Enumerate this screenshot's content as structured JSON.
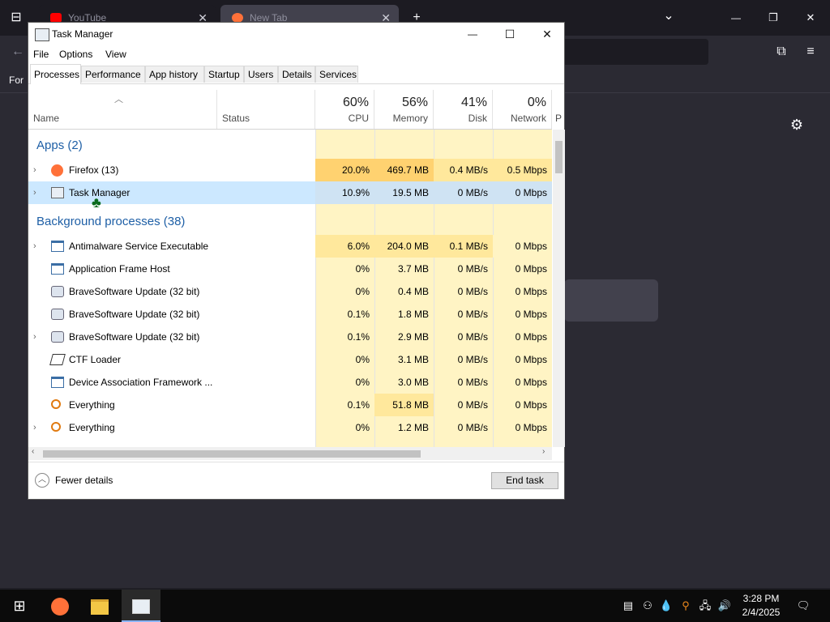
{
  "browser": {
    "tabs": [
      {
        "label": "YouTube",
        "favicon_color": "#ff0000"
      },
      {
        "label": "New Tab",
        "favicon_color": "#ff7139"
      }
    ],
    "new_tab_symbol": "+",
    "list_tabs_symbol": "⌄",
    "window_controls": {
      "minimize": "—",
      "restore": "❐",
      "close": "✕"
    },
    "bookmarks_bar_text": "For"
  },
  "task_manager": {
    "title": "Task Manager",
    "window_controls": {
      "minimize": "—",
      "maximize": "☐",
      "close": "✕"
    },
    "menu": [
      "File",
      "Options",
      "View"
    ],
    "tabs": [
      "Processes",
      "Performance",
      "App history",
      "Startup",
      "Users",
      "Details",
      "Services"
    ],
    "active_tab": "Processes",
    "columns": {
      "name": "Name",
      "status": "Status",
      "cpu": {
        "label": "CPU",
        "percent": "60%"
      },
      "memory": {
        "label": "Memory",
        "percent": "56%"
      },
      "disk": {
        "label": "Disk",
        "percent": "41%"
      },
      "network": {
        "label": "Network",
        "percent": "0%"
      },
      "power": "P"
    },
    "groups": {
      "apps": "Apps (2)",
      "background": "Background processes (38)"
    },
    "apps": [
      {
        "name": "Firefox (13)",
        "cpu": "20.0%",
        "memory": "469.7 MB",
        "disk": "0.4 MB/s",
        "network": "0.5 Mbps",
        "expandable": true,
        "icon": "firefox-icon"
      },
      {
        "name": "Task Manager",
        "cpu": "10.9%",
        "memory": "19.5 MB",
        "disk": "0 MB/s",
        "network": "0 Mbps",
        "expandable": true,
        "icon": "task-manager-icon",
        "selected": true
      }
    ],
    "background": [
      {
        "name": "Antimalware Service Executable",
        "cpu": "6.0%",
        "memory": "204.0 MB",
        "disk": "0.1 MB/s",
        "network": "0 Mbps",
        "expandable": true,
        "icon": "service-icon"
      },
      {
        "name": "Application Frame Host",
        "cpu": "0%",
        "memory": "3.7 MB",
        "disk": "0 MB/s",
        "network": "0 Mbps",
        "expandable": false,
        "icon": "service-icon"
      },
      {
        "name": "BraveSoftware Update (32 bit)",
        "cpu": "0%",
        "memory": "0.4 MB",
        "disk": "0 MB/s",
        "network": "0 Mbps",
        "expandable": false,
        "icon": "updater-icon"
      },
      {
        "name": "BraveSoftware Update (32 bit)",
        "cpu": "0.1%",
        "memory": "1.8 MB",
        "disk": "0 MB/s",
        "network": "0 Mbps",
        "expandable": false,
        "icon": "updater-icon"
      },
      {
        "name": "BraveSoftware Update (32 bit)",
        "cpu": "0.1%",
        "memory": "2.9 MB",
        "disk": "0 MB/s",
        "network": "0 Mbps",
        "expandable": true,
        "icon": "updater-icon"
      },
      {
        "name": "CTF Loader",
        "cpu": "0%",
        "memory": "3.1 MB",
        "disk": "0 MB/s",
        "network": "0 Mbps",
        "expandable": false,
        "icon": "pen-icon"
      },
      {
        "name": "Device Association Framework ...",
        "cpu": "0%",
        "memory": "3.0 MB",
        "disk": "0 MB/s",
        "network": "0 Mbps",
        "expandable": false,
        "icon": "service-icon"
      },
      {
        "name": "Everything",
        "cpu": "0.1%",
        "memory": "51.8 MB",
        "disk": "0 MB/s",
        "network": "0 Mbps",
        "expandable": false,
        "icon": "search-icon"
      },
      {
        "name": "Everything",
        "cpu": "0%",
        "memory": "1.2 MB",
        "disk": "0 MB/s",
        "network": "0 Mbps",
        "expandable": true,
        "icon": "search-icon"
      }
    ],
    "footer": {
      "fewer_details": "Fewer details",
      "end_task": "End task"
    }
  },
  "taskbar": {
    "clock_time": "3:28 PM",
    "clock_date": "2/4/2025"
  }
}
